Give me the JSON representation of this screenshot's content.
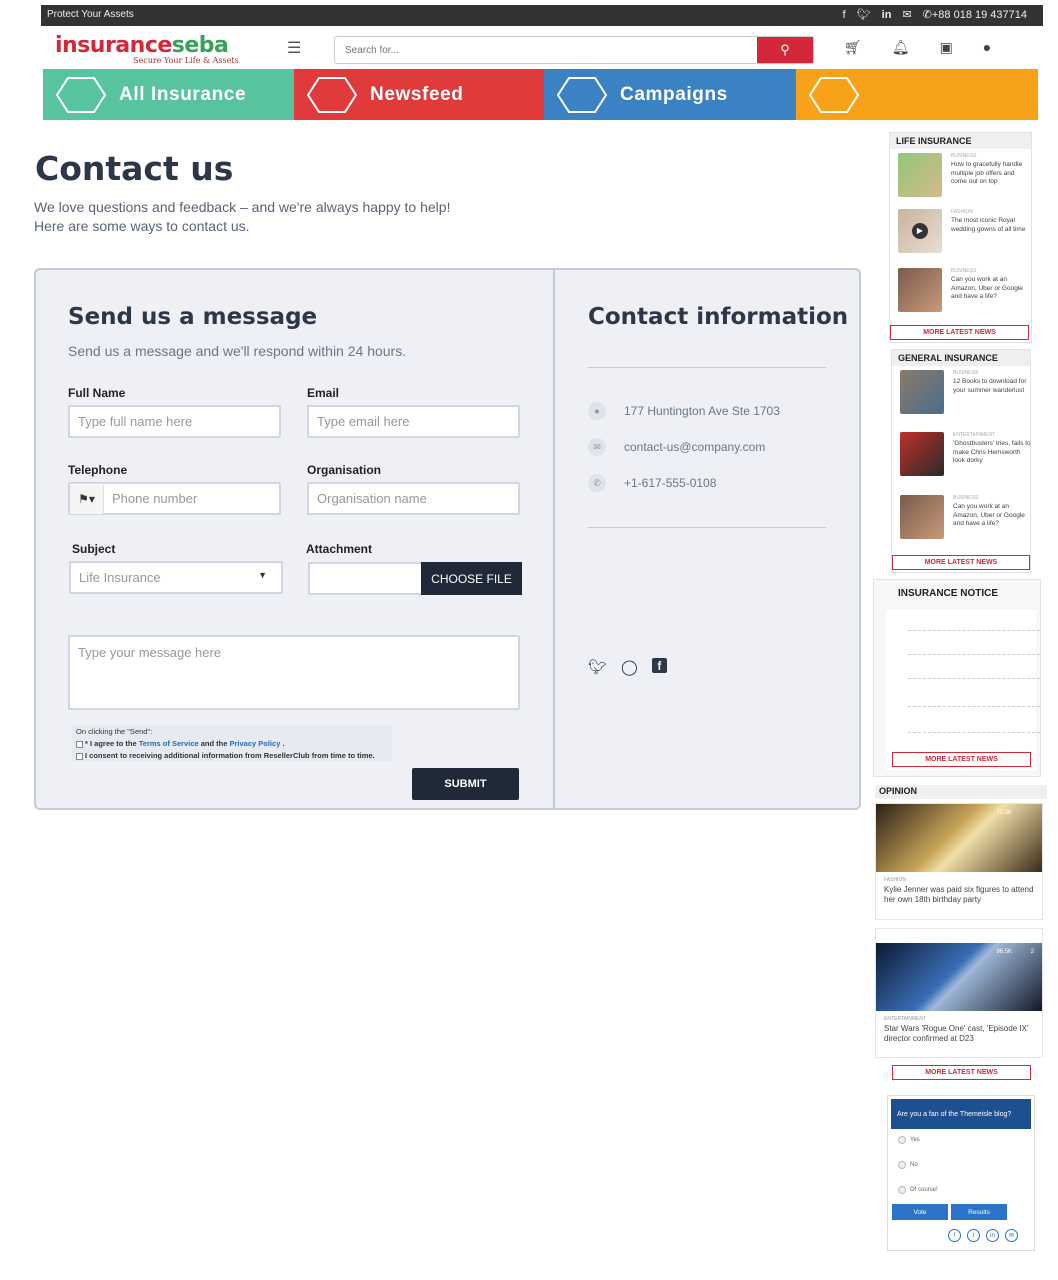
{
  "topbar": {
    "tagline": "Protect Your Assets",
    "phone": "+88 018 19 437714",
    "social_icons": [
      "facebook-icon",
      "twitter-icon",
      "linkedin-icon",
      "mail-icon",
      "phone-icon"
    ]
  },
  "header": {
    "logo_part1": "insurance",
    "logo_part2": "seba",
    "logo_tagline": "Secure Your Life & Assets",
    "search_placeholder": "Search for...",
    "brand_red": "#d3283a",
    "brand_green": "#3aa15c"
  },
  "tiles": [
    {
      "label": "All Insurance",
      "color": "#57c3a1"
    },
    {
      "label": "Newsfeed",
      "color": "#e03a3a"
    },
    {
      "label": "Campaigns",
      "color": "#3b82c4"
    },
    {
      "label": "",
      "color": "#f7a219"
    }
  ],
  "page": {
    "title": "Contact us",
    "intro_line1": "We love questions and feedback – and we're always happy to help!",
    "intro_line2": "Here are some ways to contact us."
  },
  "form": {
    "heading": "Send us a message",
    "subheading": "Send us a message and we'll respond within 24 hours.",
    "full_name_label": "Full Name",
    "full_name_placeholder": "Type full name here",
    "email_label": "Email",
    "email_placeholder": "Type email here",
    "telephone_label": "Telephone",
    "telephone_placeholder": "Phone number",
    "organisation_label": "Organisation",
    "organisation_placeholder": "Organisation name",
    "subject_label": "Subject",
    "subject_value": "Life Insurance",
    "attachment_label": "Attachment",
    "choose_file": "CHOOSE FILE",
    "message_placeholder": "Type your message here",
    "consent_intro": "On clicking the \"Send\":",
    "consent1_a": "* I agree to the ",
    "consent1_tos": "Terms of Service",
    "consent1_b": " and the ",
    "consent1_pp": "Privacy Policy",
    "consent1_c": " .",
    "consent2": "I consent to receiving additional information from ResellerClub from time to time.",
    "submit": "SUBMIT"
  },
  "contact": {
    "heading": "Contact information",
    "address": "177 Huntington Ave Ste 1703",
    "email": "contact-us@company.com",
    "phone": "+1-617-555-0108"
  },
  "sidebar": {
    "life": {
      "title": "LIFE INSURANCE",
      "items": [
        {
          "cat": "BUSINESS",
          "title": "How to gracefully handle multiple job offers and come out on top"
        },
        {
          "cat": "FASHION",
          "title": "The most iconic Royal wedding gowns of all time"
        },
        {
          "cat": "BUSINESS",
          "title": "Can you work at an Amazon, Uber or Google and have a life?"
        }
      ]
    },
    "general": {
      "title": "GENERAL INSURANCE",
      "items": [
        {
          "cat": "BUSINESS",
          "title": "12 Books to download for your summer wanderlust"
        },
        {
          "cat": "ENTERTAINMENT",
          "title": "'Ghostbusters' tries, fails to make Chris Hemsworth look dorky"
        },
        {
          "cat": "BUSINESS",
          "title": "Can you work at an Amazon, Uber or Google and have a life?"
        }
      ]
    },
    "more": "MORE LATEST NEWS",
    "notice_title": "INSURANCE NOTICE",
    "opinion": {
      "title": "OPINION",
      "items": [
        {
          "cat": "FASHION",
          "title": "Kylie Jenner was paid six figures to attend her own 18th birthday party",
          "views": "72.0K"
        },
        {
          "cat": "ENTERTAINMENT",
          "title": "Star Wars 'Rogue One' cast, 'Episode IX' director confirmed at D23",
          "views": "96.5K",
          "comments": "2"
        }
      ]
    },
    "poll": {
      "question": "Are you a fan of the Themeisle blog?",
      "options": [
        "Yes",
        "No",
        "Of course!"
      ],
      "vote": "Vote",
      "results": "Results"
    }
  }
}
